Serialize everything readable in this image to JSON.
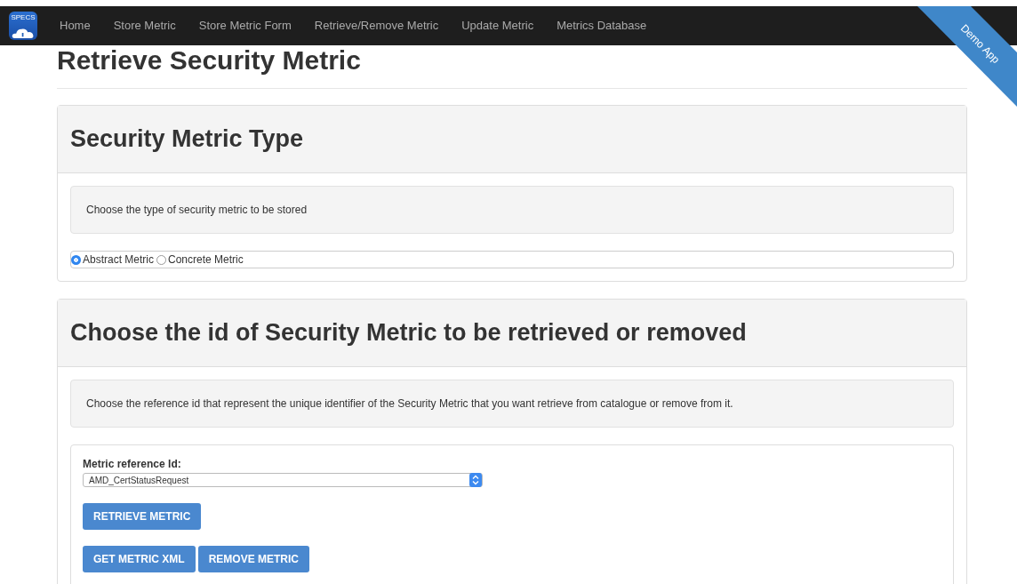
{
  "navbar": {
    "logo_text": "SPECS",
    "items": [
      {
        "label": "Home"
      },
      {
        "label": "Store Metric"
      },
      {
        "label": "Store Metric Form"
      },
      {
        "label": "Retrieve/Remove Metric"
      },
      {
        "label": "Update Metric"
      },
      {
        "label": "Metrics Database"
      }
    ]
  },
  "ribbon": "Demo App",
  "page_title": "Retrieve Security Metric",
  "type_panel": {
    "title": "Security Metric Type",
    "info": "Choose the type of security metric to be stored",
    "options": [
      {
        "label": "Abstract Metric",
        "selected": true
      },
      {
        "label": "Concrete Metric",
        "selected": false
      }
    ]
  },
  "id_panel": {
    "title": "Choose the id of Security Metric to be retrieved or removed",
    "info": "Choose the reference id that represent the unique identifier of the Security Metric that you want retrieve from catalogue or remove from it.",
    "field_label": "Metric reference Id:",
    "select_value": "AMD_CertStatusRequest",
    "buttons": [
      [
        "RETRIEVE METRIC"
      ],
      [
        "GET METRIC XML",
        "REMOVE METRIC"
      ]
    ]
  }
}
